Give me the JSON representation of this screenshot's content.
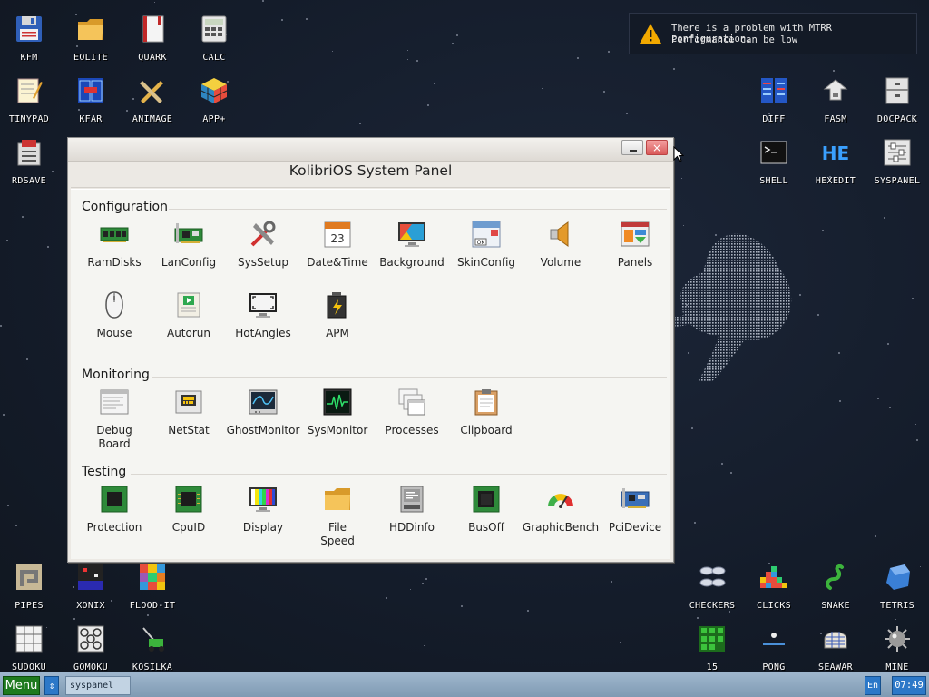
{
  "desktop": {
    "icons_left": [
      {
        "label": "KFM",
        "icon": "floppy-disk-icon"
      },
      {
        "label": "EOLITE",
        "icon": "folder-icon"
      },
      {
        "label": "QUARK",
        "icon": "notebook-icon"
      },
      {
        "label": "CALC",
        "icon": "calculator-icon"
      },
      {
        "label": "TINYPAD",
        "icon": "notepad-icon"
      },
      {
        "label": "KFAR",
        "icon": "file-manager-icon"
      },
      {
        "label": "ANIMAGE",
        "icon": "paint-tools-icon"
      },
      {
        "label": "APP+",
        "icon": "rubik-cube-icon"
      },
      {
        "label": "RDSAVE",
        "icon": "ramdisk-save-icon"
      }
    ],
    "icons_right_top": [
      {
        "label": "DIFF",
        "icon": "diff-icon"
      },
      {
        "label": "FASM",
        "icon": "assembler-icon"
      },
      {
        "label": "DOCPACK",
        "icon": "docpack-icon"
      },
      {
        "label": "SHELL",
        "icon": "terminal-icon"
      },
      {
        "label": "HEXEDIT",
        "icon": "hex-editor-icon"
      },
      {
        "label": "SYSPANEL",
        "icon": "sliders-icon"
      }
    ],
    "icons_bottom_left": [
      {
        "label": "PIPES",
        "icon": "pipes-icon"
      },
      {
        "label": "XONIX",
        "icon": "xonix-icon"
      },
      {
        "label": "FLOOD-IT",
        "icon": "flood-it-icon"
      },
      {
        "label": "SUDOKU",
        "icon": "sudoku-icon"
      },
      {
        "label": "GOMOKU",
        "icon": "gomoku-icon"
      },
      {
        "label": "KOSILKA",
        "icon": "lawnmower-icon"
      }
    ],
    "icons_bottom_right": [
      {
        "label": "CHECKERS",
        "icon": "checkers-icon"
      },
      {
        "label": "CLICKS",
        "icon": "clicks-icon"
      },
      {
        "label": "SNAKE",
        "icon": "snake-icon"
      },
      {
        "label": "TETRIS",
        "icon": "tetris-icon"
      },
      {
        "label": "15",
        "icon": "fifteen-puzzle-icon"
      },
      {
        "label": "PONG",
        "icon": "pong-icon"
      },
      {
        "label": "SEAWAR",
        "icon": "seawar-icon"
      },
      {
        "label": "MINE",
        "icon": "mine-icon"
      }
    ]
  },
  "notification": {
    "line1": "There is a problem with MTRR configuration.",
    "line2": "Performance can be low",
    "icon": "warning-icon",
    "color": "#f2a900"
  },
  "window": {
    "title": "KolibriOS System Panel",
    "close_glyph": "×",
    "sections": [
      {
        "title": "Configuration",
        "items": [
          {
            "label": "RamDisks",
            "icon": "ram-module-icon"
          },
          {
            "label": "LanConfig",
            "icon": "network-card-icon"
          },
          {
            "label": "SysSetup",
            "icon": "tools-icon"
          },
          {
            "label": "Date&Time",
            "icon": "calendar-icon",
            "day": "23"
          },
          {
            "label": "Background",
            "icon": "monitor-wallpaper-icon"
          },
          {
            "label": "SkinConfig",
            "icon": "skin-window-icon",
            "ok": "OK"
          },
          {
            "label": "Volume",
            "icon": "speaker-icon"
          },
          {
            "label": "Panels",
            "icon": "panels-icon"
          },
          {
            "label": "Mouse",
            "icon": "mouse-icon"
          },
          {
            "label": "Autorun",
            "icon": "autorun-scroll-icon"
          },
          {
            "label": "HotAngles",
            "icon": "hot-angles-icon"
          },
          {
            "label": "APM",
            "icon": "battery-icon"
          }
        ]
      },
      {
        "title": "Monitoring",
        "items": [
          {
            "label": "Debug\nBoard",
            "icon": "debug-board-icon"
          },
          {
            "label": "NetStat",
            "icon": "network-status-icon"
          },
          {
            "label": "GhostMonitor",
            "icon": "ghost-monitor-icon"
          },
          {
            "label": "SysMonitor",
            "icon": "system-monitor-icon"
          },
          {
            "label": "Processes",
            "icon": "processes-icon"
          },
          {
            "label": "Clipboard",
            "icon": "clipboard-icon"
          }
        ]
      },
      {
        "title": "Testing",
        "items": [
          {
            "label": "Protection",
            "icon": "cpu-chip-icon"
          },
          {
            "label": "CpuID",
            "icon": "cpu-chip-icon"
          },
          {
            "label": "Display",
            "icon": "display-color-bars-icon"
          },
          {
            "label": "File\nSpeed",
            "icon": "folder-icon"
          },
          {
            "label": "HDDinfo",
            "icon": "hard-disk-icon"
          },
          {
            "label": "BusOff",
            "icon": "cpu-chip-green-icon"
          },
          {
            "label": "GraphicBench",
            "icon": "gauge-icon"
          },
          {
            "label": "PciDevice",
            "icon": "pci-card-icon"
          }
        ]
      }
    ]
  },
  "taskbar": {
    "menu_label": "Menu",
    "switch_glyph": "⇕",
    "task_label": "syspanel",
    "lang": "En",
    "clock": "07:49",
    "color": "#8aa6c0"
  }
}
